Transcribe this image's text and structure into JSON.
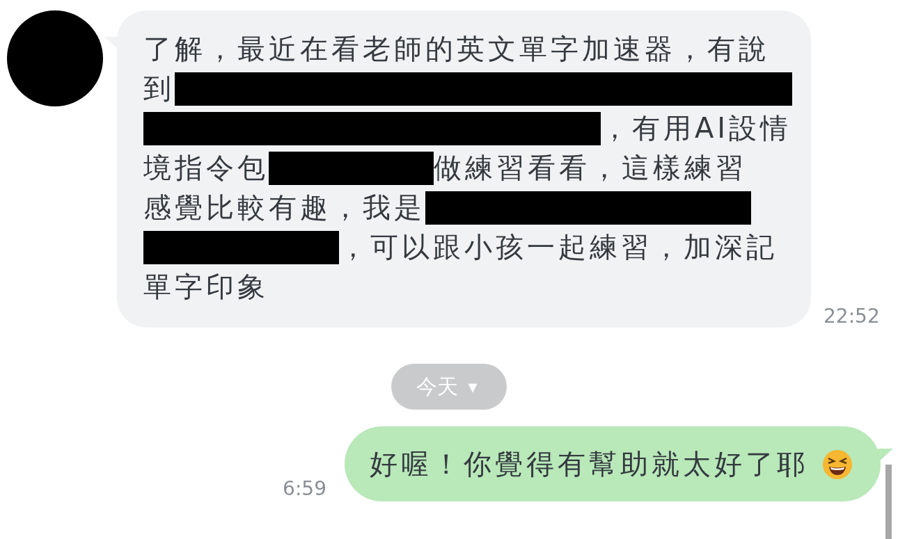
{
  "messages": [
    {
      "kind": "received",
      "time": "22:52",
      "lines": [
        [
          {
            "kind": "text",
            "text": "了解，最近在看老師的英文單字加速器，有說"
          }
        ],
        [
          {
            "kind": "text",
            "text": "到"
          },
          {
            "kind": "redaction"
          }
        ],
        [
          {
            "kind": "redaction"
          },
          {
            "kind": "text",
            "text": "，有用AI設情"
          }
        ],
        [
          {
            "kind": "text",
            "text": "境指令包"
          },
          {
            "kind": "redaction"
          },
          {
            "kind": "text",
            "text": "做練習看看，這樣練習"
          }
        ],
        [
          {
            "kind": "text",
            "text": "感覺比較有趣，我是"
          },
          {
            "kind": "redaction"
          }
        ],
        [
          {
            "kind": "redaction"
          },
          {
            "kind": "text",
            "text": "，可以跟小孩一起練習，加深記"
          }
        ],
        [
          {
            "kind": "text",
            "text": "單字印象"
          }
        ]
      ]
    },
    {
      "kind": "divider",
      "label": "今天",
      "caret": "▾"
    },
    {
      "kind": "sent",
      "time": "6:59",
      "lines": [
        [
          {
            "kind": "text",
            "text": "好喔！你覺得有幫助就太好了耶"
          },
          {
            "kind": "emoji"
          }
        ]
      ]
    }
  ]
}
